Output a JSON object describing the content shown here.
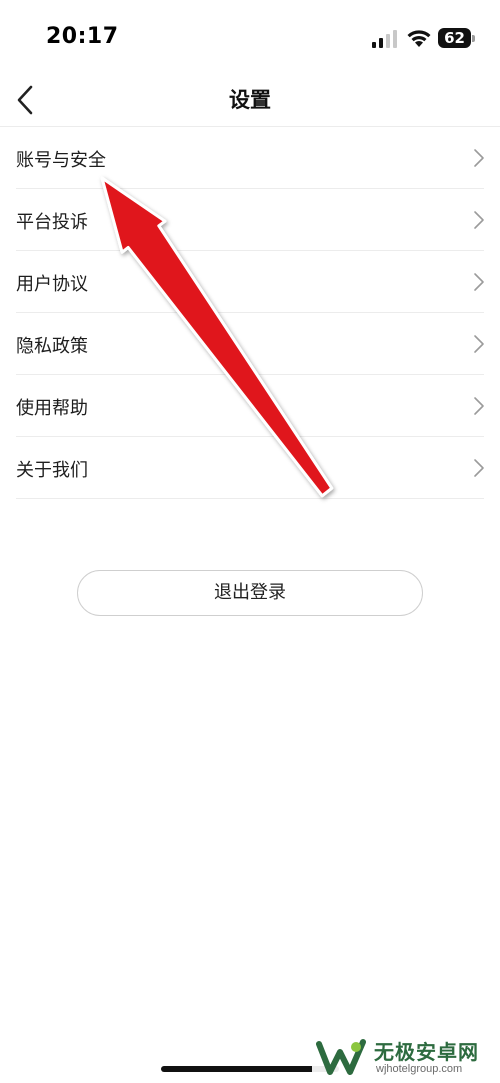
{
  "status_bar": {
    "time": "20:17",
    "battery_level": "62",
    "icons": [
      "signal-icon",
      "wifi-icon",
      "battery-icon"
    ]
  },
  "nav": {
    "title": "设置",
    "back_icon": "chevron-left-icon"
  },
  "menu": {
    "items": [
      {
        "label": "账号与安全"
      },
      {
        "label": "平台投诉"
      },
      {
        "label": "用户协议"
      },
      {
        "label": "隐私政策"
      },
      {
        "label": "使用帮助"
      },
      {
        "label": "关于我们"
      }
    ],
    "item_icon": "chevron-right-icon"
  },
  "logout": {
    "label": "退出登录"
  },
  "watermark": {
    "title": "无极安卓网",
    "url": "wjhotelgroup.com"
  },
  "colors": {
    "annotation_arrow": "#e0141c",
    "divider": "#ececec",
    "watermark_green": "#2d6b3f"
  }
}
